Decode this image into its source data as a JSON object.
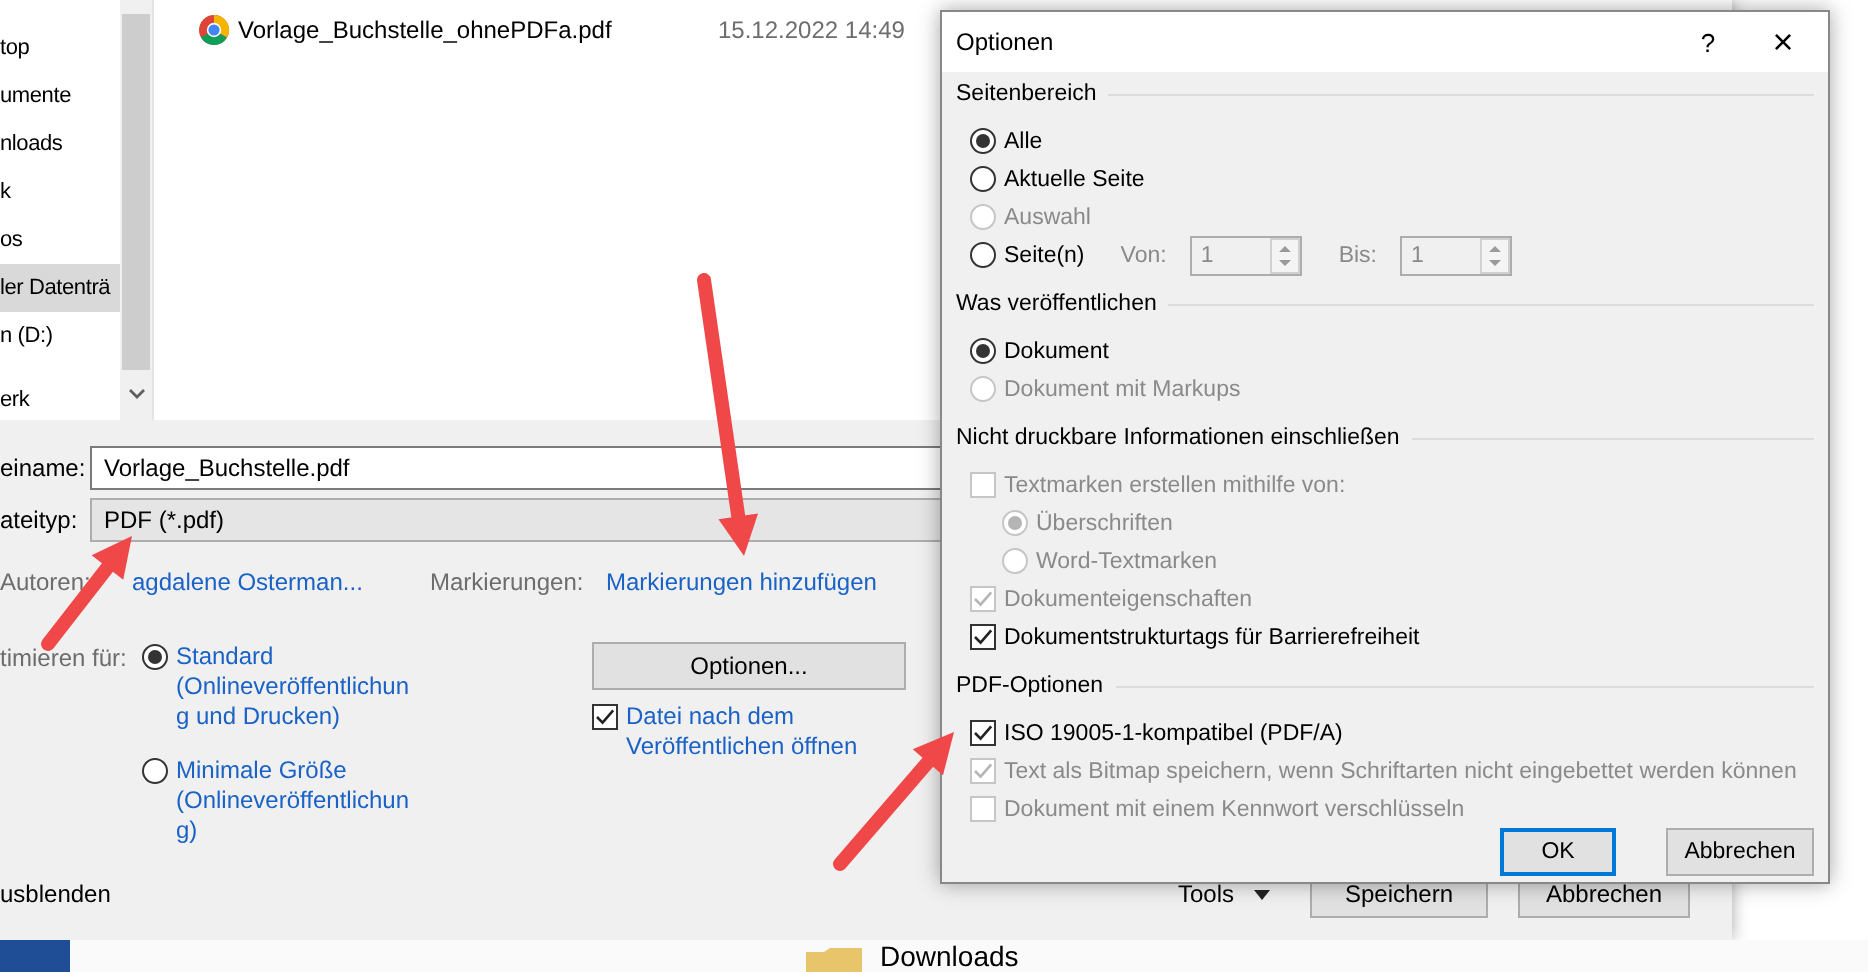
{
  "save_dialog": {
    "sidebar": {
      "items": [
        {
          "label": "top",
          "selected": false
        },
        {
          "label": "umente",
          "selected": false
        },
        {
          "label": "nloads",
          "selected": false
        },
        {
          "label": "k",
          "selected": false
        },
        {
          "label": "os",
          "selected": false
        },
        {
          "label": "ler Datenträ",
          "selected": true
        },
        {
          "label": "n (D:)",
          "selected": false
        },
        {
          "label": "erk",
          "selected": false
        }
      ]
    },
    "files": [
      {
        "name": "Vorlage_Buchstelle_ohnePDFa.pdf",
        "date": "15.12.2022 14:49"
      }
    ],
    "filename": {
      "label": "einame:",
      "value": "Vorlage_Buchstelle.pdf"
    },
    "filetype": {
      "label": "ateityp:",
      "value": "PDF (*.pdf)"
    },
    "authors": {
      "label": "Autoren:",
      "value": "agdalene Osterman..."
    },
    "tags": {
      "label": "Markierungen:",
      "value": "Markierungen hinzufügen"
    },
    "optimize": {
      "label": "timieren für:",
      "options": [
        {
          "label": "Standard (Onlineveröffentlichung und Drucken)",
          "selected": true
        },
        {
          "label": "Minimale Größe (Onlineveröffentlichung)",
          "selected": false
        }
      ]
    },
    "options_button": "Optionen...",
    "open_after": {
      "label": "Datei nach dem Veröffentlichen öffnen",
      "checked": true
    },
    "hide_folders": "usblenden",
    "tools": "Tools",
    "buttons": [
      "Speichern",
      "Abbrechen"
    ]
  },
  "background_window": {
    "item": "Downloads"
  },
  "options_dialog": {
    "title": "Optionen",
    "help": "?",
    "close": "×",
    "sections": [
      {
        "title": "Seitenbereich",
        "items": [
          {
            "kind": "radio",
            "label": "Alle",
            "selected": true,
            "disabled": false
          },
          {
            "kind": "radio",
            "label": "Aktuelle Seite",
            "selected": false,
            "disabled": false
          },
          {
            "kind": "radio",
            "label": "Auswahl",
            "selected": false,
            "disabled": true
          },
          {
            "kind": "range",
            "label": "Seite(n)",
            "selected": false,
            "disabled": false,
            "fields_disabled": true,
            "from_label": "Von:",
            "from_value": "1",
            "to_label": "Bis:",
            "to_value": "1"
          }
        ]
      },
      {
        "title": "Was veröffentlichen",
        "items": [
          {
            "kind": "radio",
            "label": "Dokument",
            "selected": true,
            "disabled": false
          },
          {
            "kind": "radio",
            "label": "Dokument mit Markups",
            "selected": false,
            "disabled": true
          }
        ]
      },
      {
        "title": "Nicht druckbare Informationen einschließen",
        "items": [
          {
            "kind": "checkbox",
            "label": "Textmarken erstellen mithilfe von:",
            "checked": false,
            "disabled": true,
            "children": [
              {
                "kind": "radio",
                "label": "Überschriften",
                "selected": true,
                "disabled": true
              },
              {
                "kind": "radio",
                "label": "Word-Textmarken",
                "selected": false,
                "disabled": true
              }
            ]
          },
          {
            "kind": "checkbox",
            "label": "Dokumenteigenschaften",
            "checked": true,
            "disabled": true
          },
          {
            "kind": "checkbox",
            "label": "Dokumentstrukturtags für Barrierefreiheit",
            "checked": true,
            "disabled": false
          }
        ]
      },
      {
        "title": "PDF-Optionen",
        "items": [
          {
            "kind": "checkbox",
            "label": "ISO 19005-1-kompatibel (PDF/A)",
            "checked": true,
            "disabled": false
          },
          {
            "kind": "checkbox",
            "label": "Text als Bitmap speichern, wenn Schriftarten nicht eingebettet werden können",
            "checked": true,
            "disabled": true
          },
          {
            "kind": "checkbox",
            "label": "Dokument mit einem Kennwort verschlüsseln",
            "checked": false,
            "disabled": true
          }
        ]
      }
    ],
    "buttons": [
      {
        "label": "OK",
        "default": true
      },
      {
        "label": "Abbrechen",
        "default": false
      }
    ]
  }
}
